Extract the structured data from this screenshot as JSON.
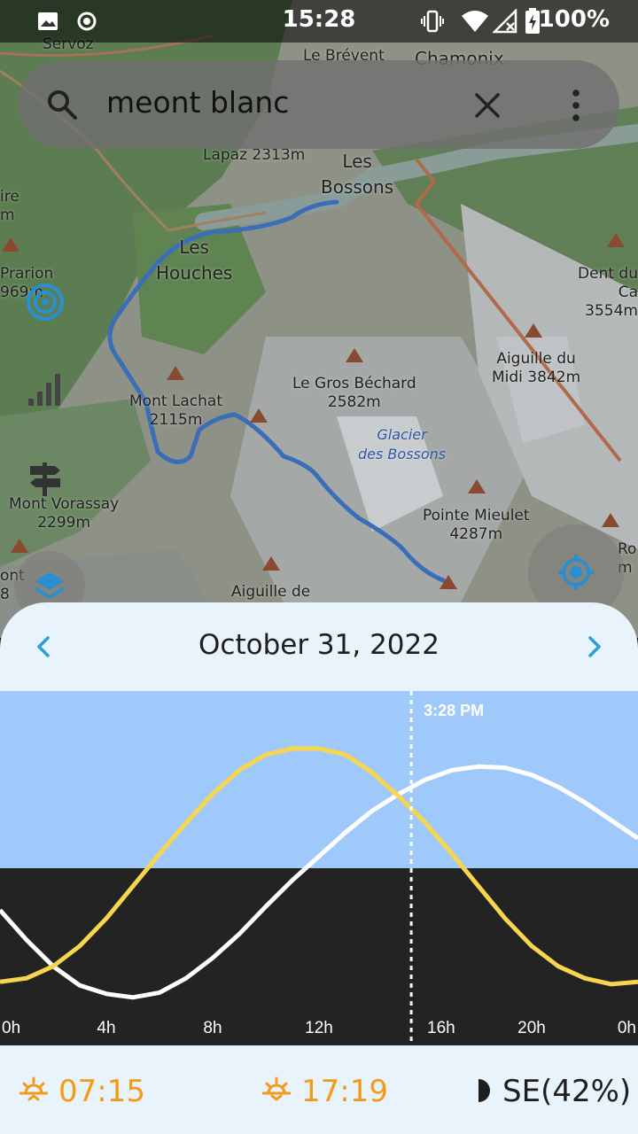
{
  "status_bar": {
    "time": "15:28",
    "battery": "100%"
  },
  "search": {
    "query": "meont blanc"
  },
  "map": {
    "labels": {
      "servoz": "Servoz",
      "le_brevent": "Le Brévent",
      "chamonix": "Chamonix",
      "lapaz": "Lapaz 2313m",
      "les_bossons": "Les\nBossons",
      "les_houches": "Les\nHouches",
      "prarion": "Prarion\n969m",
      "dent_du": "Dent du Ca\n3554m",
      "aiguille_midi": "Aiguille du\nMidi 3842m",
      "le_gros_bechard": "Le Gros Béchard\n2582m",
      "mont_lachat": "Mont Lachat\n2115m",
      "glacier": "Glacier\ndes Bossons",
      "mont_vorassay": "Mont Vorassay\n2299m",
      "pointe_mieulet": "Pointe Mieulet\n4287m",
      "aiguille_de": "Aiguille de",
      "ro": "Ro\nm",
      "ont": "ont\n8",
      "ire": "ire\nm"
    }
  },
  "sheet": {
    "date": "October 31, 2022",
    "current_time_label": "3:28 PM",
    "sunrise": "07:15",
    "sunset": "17:19",
    "moon": "SE(42%)"
  },
  "chart_data": {
    "type": "line",
    "x_label_ticks": [
      "0h",
      "4h",
      "8h",
      "12h",
      "16h",
      "20h",
      "0h"
    ],
    "x_range": [
      0,
      24
    ],
    "current_hour": 15.47,
    "colors": {
      "sun": "#f7d64e",
      "moon": "#ffffff",
      "day_sky": "#a0c9fb",
      "night": "#232323"
    },
    "series": [
      {
        "x": [
          0,
          1,
          2,
          3,
          4,
          5,
          6,
          7,
          8,
          9,
          10,
          11,
          12,
          13,
          14,
          15,
          16,
          17,
          18,
          19,
          20,
          21,
          22,
          23,
          24
        ],
        "y": [
          -0.95,
          -0.92,
          -0.82,
          -0.65,
          -0.42,
          -0.15,
          0.12,
          0.38,
          0.62,
          0.82,
          0.95,
          1.0,
          1.0,
          0.95,
          0.8,
          0.6,
          0.38,
          0.12,
          -0.15,
          -0.42,
          -0.65,
          -0.82,
          -0.92,
          -0.97,
          -0.95
        ]
      },
      {
        "x": [
          0,
          1,
          2,
          3,
          4,
          5,
          6,
          7,
          8,
          9,
          10,
          11,
          12,
          13,
          14,
          15,
          16,
          17,
          18,
          19,
          20,
          21,
          22,
          23,
          24
        ],
        "y": [
          -0.35,
          -0.6,
          -0.82,
          -0.98,
          -1.05,
          -1.08,
          -1.04,
          -0.92,
          -0.75,
          -0.55,
          -0.32,
          -0.1,
          0.1,
          0.3,
          0.48,
          0.62,
          0.74,
          0.82,
          0.85,
          0.84,
          0.78,
          0.68,
          0.55,
          0.4,
          0.25
        ]
      }
    ]
  }
}
